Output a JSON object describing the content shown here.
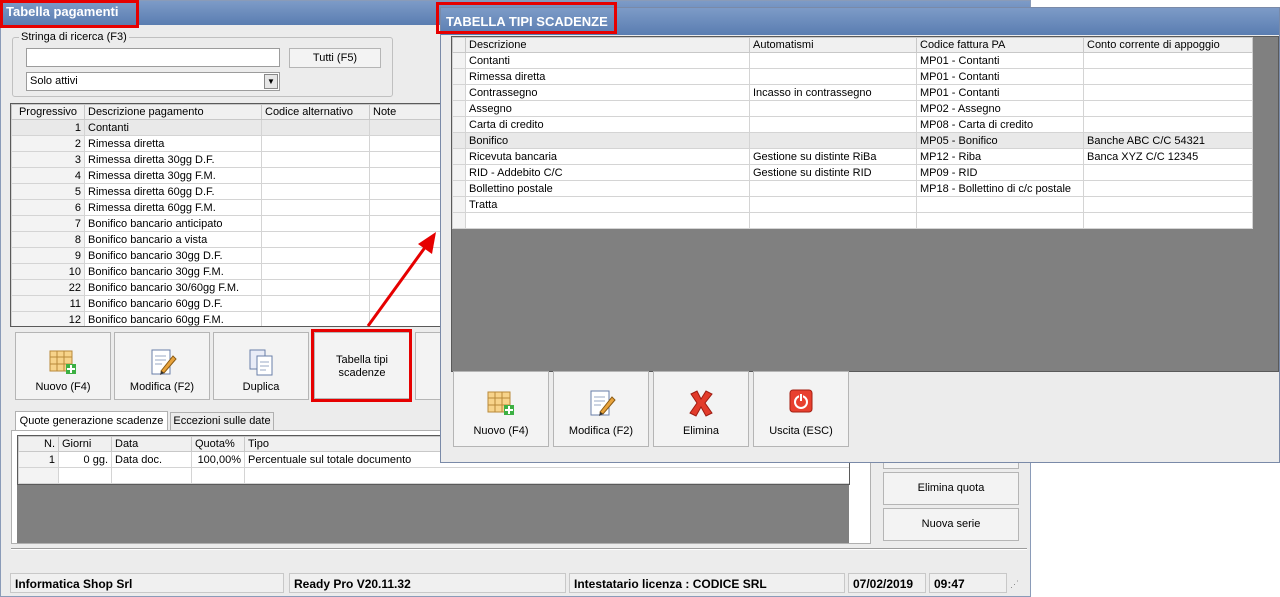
{
  "main_window": {
    "title": "Tabella pagamenti",
    "search_group_label": "Stringa di ricerca (F3)",
    "search_value": "",
    "tutti_button": "Tutti (F5)",
    "filter_selected": "Solo attivi",
    "table": {
      "headers": [
        "Progressivo",
        "Descrizione pagamento",
        "Codice alternativo",
        "Note"
      ],
      "rows": [
        {
          "prog": "1",
          "desc": "Contanti"
        },
        {
          "prog": "2",
          "desc": "Rimessa diretta"
        },
        {
          "prog": "3",
          "desc": "Rimessa diretta 30gg D.F."
        },
        {
          "prog": "4",
          "desc": "Rimessa diretta 30gg F.M."
        },
        {
          "prog": "5",
          "desc": "Rimessa diretta 60gg D.F."
        },
        {
          "prog": "6",
          "desc": "Rimessa diretta 60gg F.M."
        },
        {
          "prog": "7",
          "desc": "Bonifico bancario anticipato"
        },
        {
          "prog": "8",
          "desc": "Bonifico bancario a vista"
        },
        {
          "prog": "9",
          "desc": "Bonifico bancario 30gg D.F."
        },
        {
          "prog": "10",
          "desc": "Bonifico bancario 30gg F.M."
        },
        {
          "prog": "22",
          "desc": "Bonifico bancario 30/60gg F.M."
        },
        {
          "prog": "11",
          "desc": "Bonifico bancario 60gg D.F."
        },
        {
          "prog": "12",
          "desc": "Bonifico bancario 60gg F.M."
        }
      ]
    },
    "buttons": {
      "nuovo": "Nuovo (F4)",
      "modifica": "Modifica (F2)",
      "duplica": "Duplica",
      "tabella_line1": "Tabella tipi",
      "tabella_line2": "scadenze"
    },
    "tabs": [
      "Quote generazione scadenze",
      "Eccezioni sulle date"
    ],
    "quote_table": {
      "headers": [
        "N.",
        "Giorni",
        "Data",
        "Quota%",
        "Tipo"
      ],
      "rows": [
        {
          "n": "1",
          "giorni": "0 gg.",
          "data": "Data doc.",
          "quota": "100,00%",
          "tipo": "Percentuale sul totale documento"
        }
      ]
    },
    "side_buttons": {
      "elimina_quota": "Elimina quota",
      "nuova_serie": "Nuova serie"
    },
    "status": {
      "company": "Informatica Shop Srl",
      "version": "Ready Pro V20.11.32",
      "license": "Intestatario licenza : CODICE SRL",
      "date": "07/02/2019",
      "time": "09:47"
    }
  },
  "dialog": {
    "title": "TABELLA TIPI SCADENZE",
    "headers": [
      "Descrizione",
      "Automatismi",
      "Codice fattura PA",
      "Conto corrente di appoggio"
    ],
    "rows": [
      {
        "desc": "Contanti",
        "auto": "",
        "codice": "MP01 - Contanti",
        "conto": ""
      },
      {
        "desc": "Rimessa diretta",
        "auto": "",
        "codice": "MP01 - Contanti",
        "conto": ""
      },
      {
        "desc": "Contrassegno",
        "auto": "Incasso in contrassegno",
        "codice": "MP01 - Contanti",
        "conto": ""
      },
      {
        "desc": "Assegno",
        "auto": "",
        "codice": "MP02 - Assegno",
        "conto": ""
      },
      {
        "desc": "Carta di credito",
        "auto": "",
        "codice": "MP08 - Carta di credito",
        "conto": ""
      },
      {
        "desc": "Bonifico",
        "auto": "",
        "codice": "MP05 - Bonifico",
        "conto": "Banche ABC C/C 54321"
      },
      {
        "desc": "Ricevuta bancaria",
        "auto": "Gestione su distinte RiBa",
        "codice": "MP12 - Riba",
        "conto": "Banca XYZ C/C 12345"
      },
      {
        "desc": "RID - Addebito C/C",
        "auto": "Gestione su distinte RID",
        "codice": "MP09 - RID",
        "conto": ""
      },
      {
        "desc": "Bollettino postale",
        "auto": "",
        "codice": "MP18 - Bollettino di c/c postale",
        "conto": ""
      },
      {
        "desc": "Tratta",
        "auto": "",
        "codice": "",
        "conto": ""
      },
      {
        "desc": "",
        "auto": "",
        "codice": "",
        "conto": ""
      }
    ],
    "buttons": {
      "nuovo": "Nuovo (F4)",
      "modifica": "Modifica (F2)",
      "elimina": "Elimina",
      "uscita": "Uscita (ESC)"
    }
  },
  "colors": {
    "highlight": "#e60000",
    "titlebar": "#5a7db1"
  }
}
